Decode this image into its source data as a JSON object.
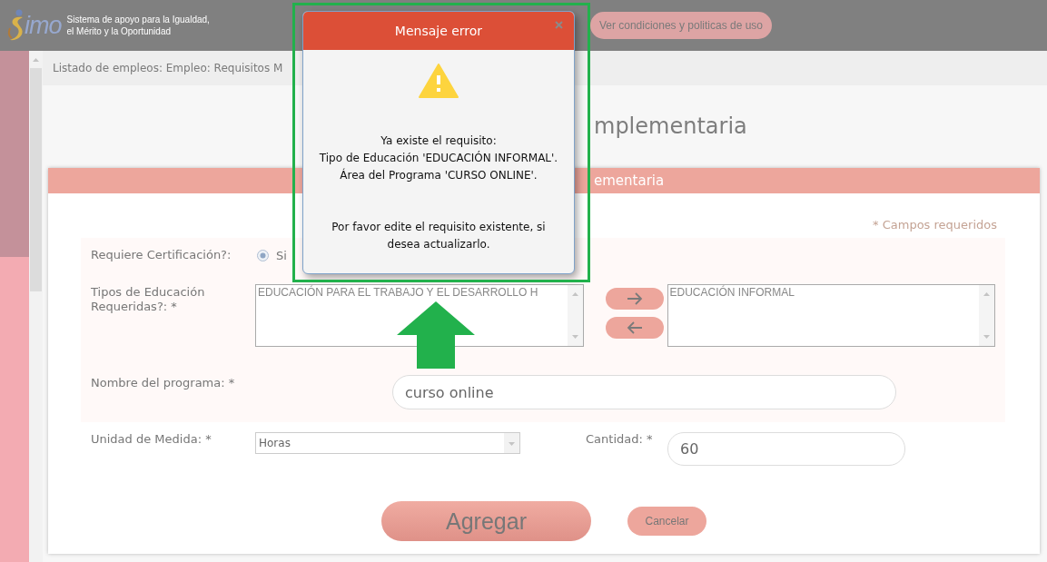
{
  "header": {
    "logo_text": "imo",
    "tagline": [
      "Sistema de apoyo para la Igualdad,",
      "el Mérito y la Oportunidad"
    ],
    "terms_link": "Ver condiciones y politicas de uso"
  },
  "breadcrumb": "Listado de empleos: Empleo: Requisitos M",
  "page_title": "mplementaria",
  "panel": {
    "title": "ementaria",
    "required_note": "* Campos requeridos",
    "certification": {
      "label": "Requiere Certificación?:",
      "options": [
        {
          "label": "Si",
          "selected": true
        }
      ]
    },
    "education_types": {
      "label": "Tipos de Educación Requeridas?: *",
      "available": [
        "EDUCACIÓN PARA EL TRABAJO Y EL DESARROLLO H"
      ],
      "chosen": [
        "EDUCACIÓN INFORMAL"
      ]
    },
    "program_name": {
      "label": "Nombre del programa: *",
      "value": "curso online"
    },
    "unit": {
      "label": "Unidad de Medida: *",
      "value": "Horas"
    },
    "quantity": {
      "label": "Cantidad: *",
      "value": "60"
    },
    "buttons": [
      {
        "label": "Agregar",
        "kind": "primary"
      },
      {
        "label": "Cancelar",
        "kind": "secondary"
      }
    ]
  },
  "dialog": {
    "title": "Mensaje error",
    "lines": [
      "Ya existe el requisito:",
      "Tipo de Educación 'EDUCACIÓN INFORMAL'.",
      "Área del Programa 'CURSO ONLINE'."
    ],
    "note": "Por favor edite el requisito existente, si desea actualizarlo."
  }
}
